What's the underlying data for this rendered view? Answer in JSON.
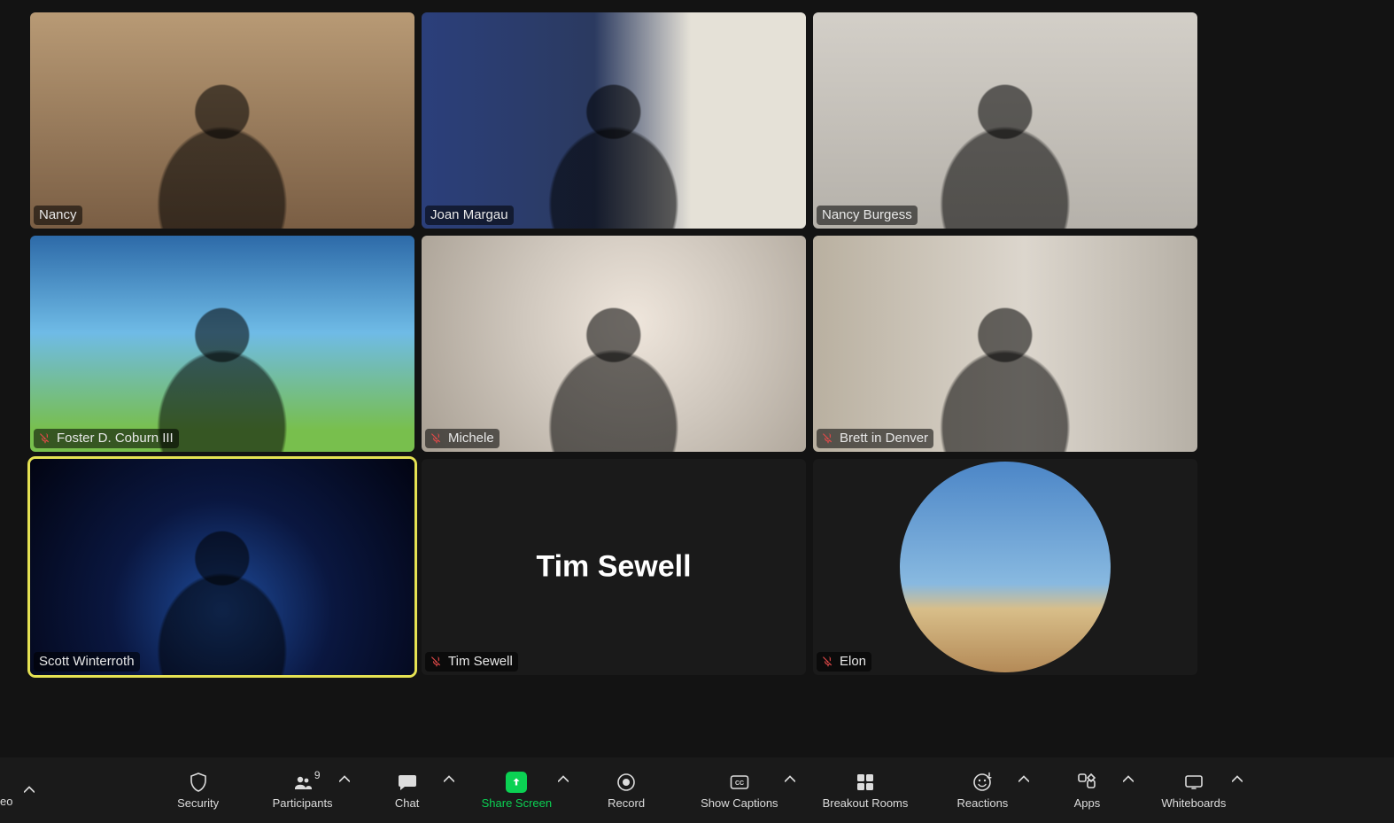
{
  "meeting": {
    "participant_count": 9,
    "active_speaker_index": 6,
    "tiles": [
      {
        "name": "Nancy",
        "muted": false,
        "video": true,
        "bg": "bg-warm"
      },
      {
        "name": "Joan Margau",
        "muted": false,
        "video": true,
        "bg": "bg-bookblue"
      },
      {
        "name": "Nancy Burgess",
        "muted": false,
        "video": true,
        "bg": "bg-light"
      },
      {
        "name": "Foster D. Coburn III",
        "muted": true,
        "video": true,
        "bg": "bg-beach"
      },
      {
        "name": "Michele",
        "muted": true,
        "video": true,
        "bg": "bg-blur1"
      },
      {
        "name": "Brett in Denver",
        "muted": true,
        "video": true,
        "bg": "bg-blur2"
      },
      {
        "name": "Scott Winterroth",
        "muted": false,
        "video": true,
        "bg": "bg-space"
      },
      {
        "name": "Tim Sewell",
        "muted": true,
        "video": false,
        "bg": "bg-dark",
        "display_name_center": "Tim Sewell"
      },
      {
        "name": "Elon",
        "muted": true,
        "video": false,
        "bg": "bg-dark",
        "avatar": "cadillac"
      }
    ]
  },
  "toolbar": {
    "video_cut_label": "eo",
    "items": [
      {
        "id": "security",
        "label": "Security",
        "chevron": false
      },
      {
        "id": "participants",
        "label": "Participants",
        "chevron": true,
        "badge_path": "meeting.participant_count"
      },
      {
        "id": "chat",
        "label": "Chat",
        "chevron": true
      },
      {
        "id": "share",
        "label": "Share Screen",
        "chevron": true,
        "green": true
      },
      {
        "id": "record",
        "label": "Record",
        "chevron": false
      },
      {
        "id": "captions",
        "label": "Show Captions",
        "chevron": true
      },
      {
        "id": "breakout",
        "label": "Breakout Rooms",
        "chevron": false
      },
      {
        "id": "reactions",
        "label": "Reactions",
        "chevron": true
      },
      {
        "id": "apps",
        "label": "Apps",
        "chevron": true
      },
      {
        "id": "whiteboards",
        "label": "Whiteboards",
        "chevron": true
      }
    ]
  }
}
